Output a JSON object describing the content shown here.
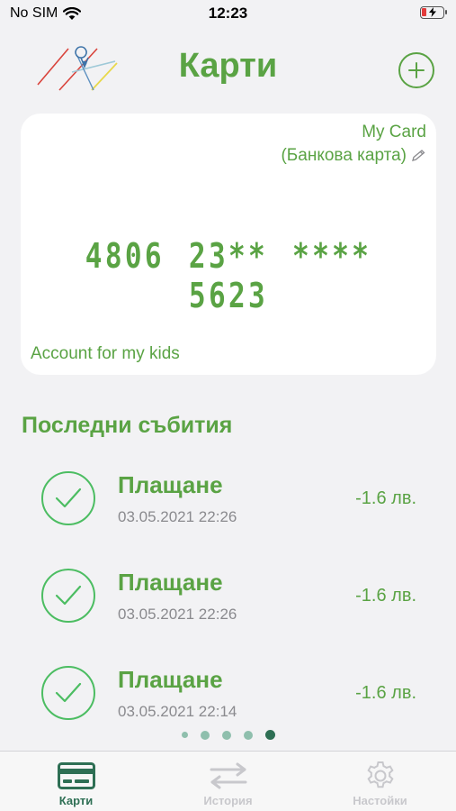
{
  "status_bar": {
    "carrier": "No SIM",
    "time": "12:23"
  },
  "header": {
    "title": "Карти",
    "add_icon": "plus-circle-icon"
  },
  "card": {
    "name": "My Card",
    "type": "(Банкова карта)",
    "number": "4806 23** **** 5623",
    "description": "Account for my kids"
  },
  "events": {
    "title": "Последни събития",
    "items": [
      {
        "title": "Плащане",
        "date": "03.05.2021 22:26",
        "amount": "-1.6 лв."
      },
      {
        "title": "Плащане",
        "date": "03.05.2021 22:26",
        "amount": "-1.6 лв."
      },
      {
        "title": "Плащане",
        "date": "03.05.2021 22:14",
        "amount": "-1.6 лв."
      }
    ]
  },
  "pager": {
    "count": 5,
    "active_index": 4
  },
  "tabs": [
    {
      "label": "Карти",
      "icon": "credit-card-icon",
      "active": true
    },
    {
      "label": "История",
      "icon": "transfer-arrows-icon",
      "active": false
    },
    {
      "label": "Настойки",
      "icon": "gear-icon",
      "active": false
    }
  ],
  "colors": {
    "brand_green": "#5aa344",
    "check_green": "#4cbd62",
    "tab_active": "#2e6f54",
    "tab_inactive": "#c8c8cc",
    "background": "#f2f2f4"
  }
}
